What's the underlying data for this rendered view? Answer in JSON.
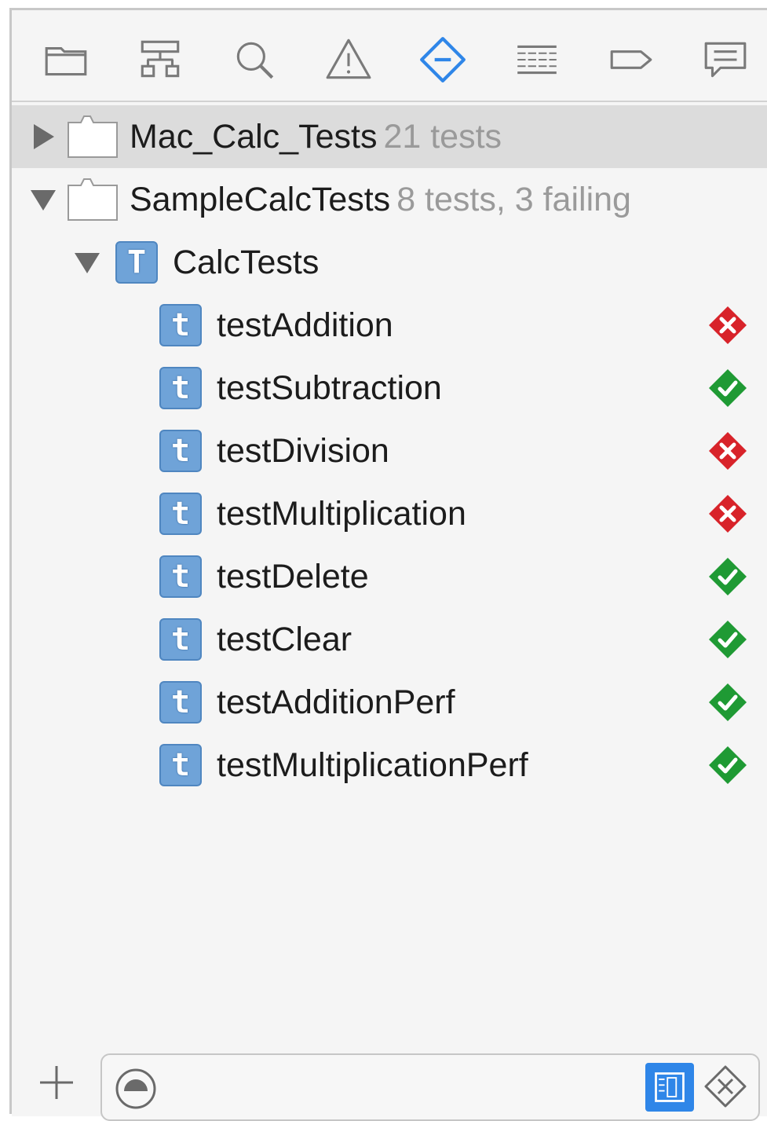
{
  "toolbar": {
    "icons": [
      "folder-icon",
      "hierarchy-icon",
      "search-icon",
      "warning-icon",
      "test-navigator-icon",
      "debug-icon",
      "breakpoint-icon",
      "report-icon"
    ],
    "active_color": "#2f86e8",
    "inactive_color": "#7a7a7a"
  },
  "tree": {
    "bundles": [
      {
        "name": "Mac_Calc_Tests",
        "summary": "21 tests",
        "expanded": false,
        "selected": true
      },
      {
        "name": "SampleCalcTests",
        "summary": "8 tests, 3 failing",
        "expanded": true,
        "selected": false
      }
    ],
    "class": {
      "icon_letter": "T",
      "name": "CalcTests",
      "expanded": true
    },
    "methods": [
      {
        "icon_letter": "t",
        "name": "testAddition",
        "status": "failed"
      },
      {
        "icon_letter": "t",
        "name": "testSubtraction",
        "status": "passed"
      },
      {
        "icon_letter": "t",
        "name": "testDivision",
        "status": "failed"
      },
      {
        "icon_letter": "t",
        "name": "testMultiplication",
        "status": "failed"
      },
      {
        "icon_letter": "t",
        "name": "testDelete",
        "status": "passed"
      },
      {
        "icon_letter": "t",
        "name": "testClear",
        "status": "passed"
      },
      {
        "icon_letter": "t",
        "name": "testAdditionPerf",
        "status": "passed"
      },
      {
        "icon_letter": "t",
        "name": "testMultiplicationPerf",
        "status": "passed"
      }
    ]
  },
  "colors": {
    "failed": "#d8232a",
    "passed": "#1f9a34",
    "test_icon": "#6fa3d8"
  },
  "bottom_bar": {
    "add_icon": "plus-icon",
    "filter_icon": "recent-filter-icon",
    "scheme_toggle_icon": "scheme-filter-icon",
    "failed_toggle_icon": "failed-filter-icon",
    "filter_value": ""
  }
}
